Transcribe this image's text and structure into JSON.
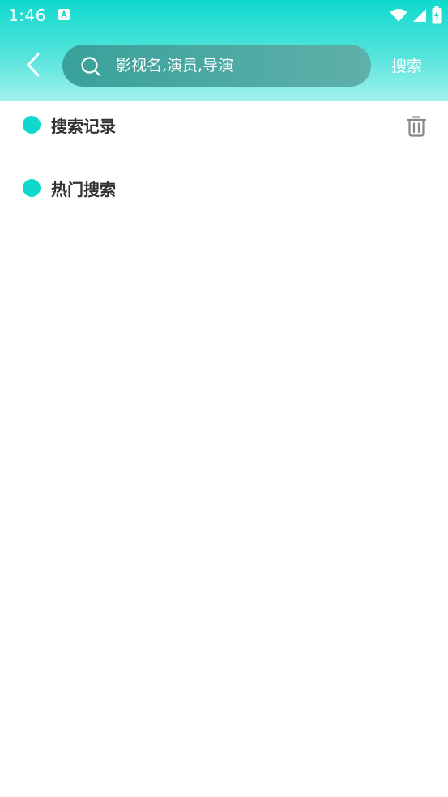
{
  "status_bar": {
    "time": "1:46",
    "notification_icon": "font-a-icon",
    "wifi_icon": "wifi-icon",
    "signal_icon": "cell-signal-icon",
    "battery_icon": "battery-charging-icon"
  },
  "nav": {
    "back_icon": "chevron-left-icon",
    "search": {
      "value": "",
      "placeholder": "影视名,演员,导演",
      "icon": "search-icon"
    },
    "search_button_label": "搜索"
  },
  "sections": {
    "history": {
      "title": "搜索记录",
      "clear_icon": "trash-icon"
    },
    "hot": {
      "title": "热门搜索"
    }
  },
  "colors": {
    "accent": "#0fd9cd",
    "header_top": "#0fd9cd",
    "header_bottom": "#a2f1ec",
    "search_box": "#4aa8a1",
    "title_text": "#333333",
    "icon_gray": "#888888"
  }
}
